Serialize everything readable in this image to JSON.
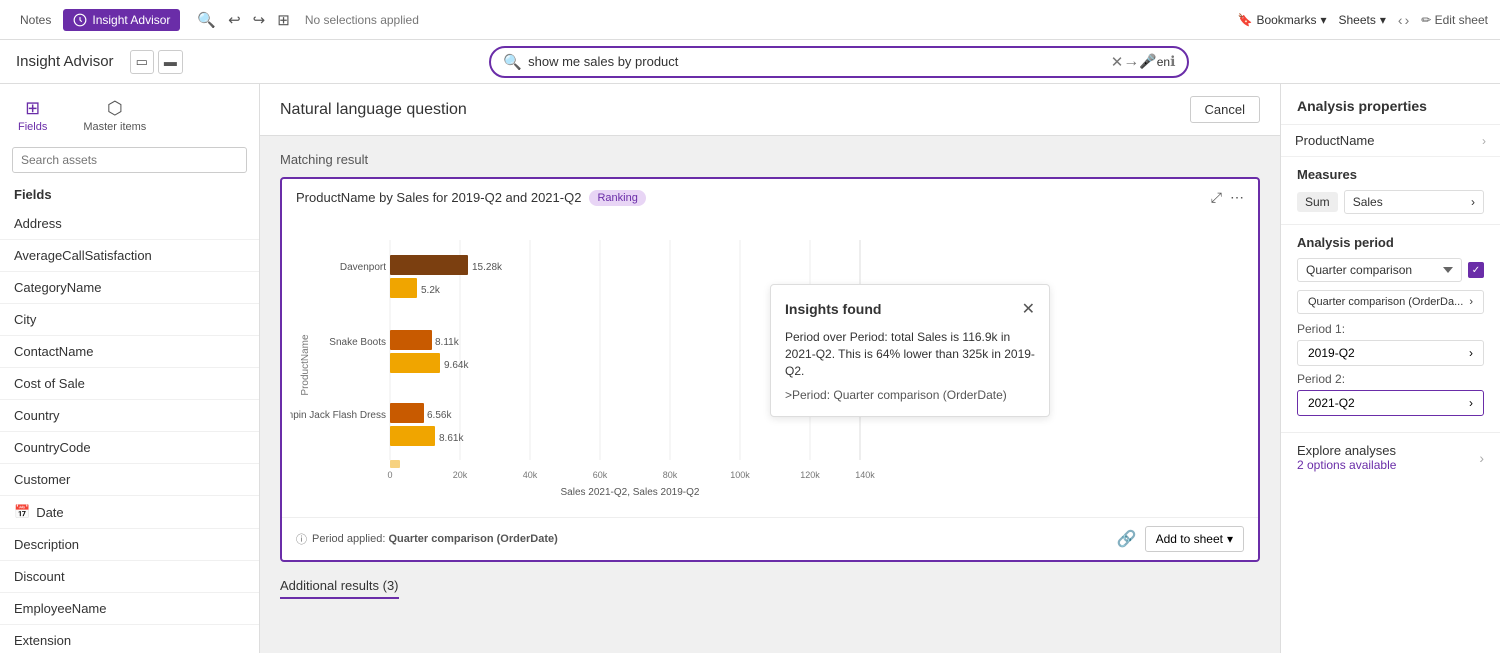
{
  "topbar": {
    "notes_label": "Notes",
    "insight_advisor_label": "Insight Advisor",
    "no_selections": "No selections applied",
    "bookmarks_label": "Bookmarks",
    "sheets_label": "Sheets",
    "edit_sheet_label": "Edit sheet"
  },
  "searchbar": {
    "query": "show me sales by product",
    "placeholder": "show me sales by product",
    "lang": "en"
  },
  "secondbar": {
    "title": "Insight Advisor"
  },
  "sidebar": {
    "search_placeholder": "Search assets",
    "fields_label": "Fields",
    "items": [
      {
        "label": "Address",
        "icon": "",
        "type": "field"
      },
      {
        "label": "AverageCallSatisfaction",
        "icon": "",
        "type": "field"
      },
      {
        "label": "CategoryName",
        "icon": "",
        "type": "field"
      },
      {
        "label": "City",
        "icon": "",
        "type": "field"
      },
      {
        "label": "ContactName",
        "icon": "",
        "type": "field"
      },
      {
        "label": "Cost of Sale",
        "icon": "",
        "type": "field"
      },
      {
        "label": "Country",
        "icon": "",
        "type": "field"
      },
      {
        "label": "CountryCode",
        "icon": "",
        "type": "field"
      },
      {
        "label": "Customer",
        "icon": "",
        "type": "field"
      },
      {
        "label": "Date",
        "icon": "📅",
        "type": "date"
      },
      {
        "label": "Description",
        "icon": "",
        "type": "field"
      },
      {
        "label": "Discount",
        "icon": "",
        "type": "field"
      },
      {
        "label": "EmployeeName",
        "icon": "",
        "type": "field"
      },
      {
        "label": "Extension",
        "icon": "",
        "type": "field"
      }
    ]
  },
  "nlq": {
    "title": "Natural language question",
    "cancel_label": "Cancel",
    "matching_result": "Matching result"
  },
  "chart": {
    "title": "ProductName by Sales for 2019-Q2 and 2021-Q2",
    "badge": "Ranking",
    "period_info": "Period applied: Quarter comparison (OrderDate)",
    "add_sheet_label": "Add to sheet",
    "x_axis_label": "Sales 2021-Q2, Sales 2019-Q2",
    "bars": [
      {
        "label": "Davenport",
        "val1": 15.28,
        "val1_label": "15.28k",
        "val2": 5.2,
        "val2_label": "5.2k"
      },
      {
        "label": "Snake Boots",
        "val1": 8.11,
        "val1_label": "8.11k",
        "val2": 9.64,
        "val2_label": "9.64k"
      },
      {
        "label": "Jumpin Jack Flash Dress",
        "val1": 6.56,
        "val1_label": "6.56k",
        "val2": 8.61,
        "val2_label": "8.61k"
      }
    ],
    "x_ticks": [
      "0",
      "20k",
      "40k",
      "60k",
      "80k",
      "100k",
      "120k",
      "140k"
    ]
  },
  "insights": {
    "title": "Insights found",
    "text": "Period over Period: total Sales is 116.9k in 2021-Q2. This is 64% lower than 325k in 2019-Q2.",
    "link": ">Period: Quarter comparison (OrderDate)"
  },
  "right_panel": {
    "title": "Analysis properties",
    "field_name": "ProductName",
    "measures_title": "Measures",
    "sum_label": "Sum",
    "sales_label": "Sales",
    "analysis_period_title": "Analysis period",
    "period_dropdown_value": "Quarter comparison",
    "quarter_comparison_label": "Quarter comparison (OrderDa...",
    "period1_label": "Period 1:",
    "period1_value": "2019-Q2",
    "period2_label": "Period 2:",
    "period2_value": "2021-Q2",
    "explore_label": "Explore analyses",
    "explore_options": "2 options available"
  },
  "additional": {
    "label": "Additional results (3)"
  }
}
